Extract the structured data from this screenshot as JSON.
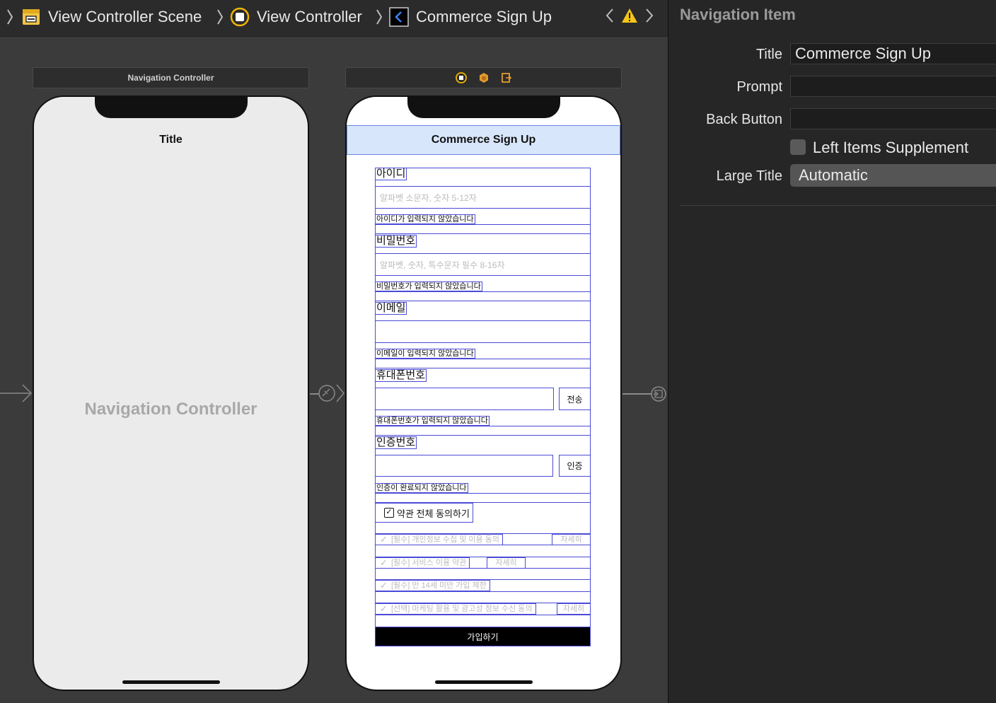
{
  "breadcrumb": {
    "items": [
      {
        "label": "View Controller Scene",
        "icon": "scene-icon"
      },
      {
        "label": "View Controller",
        "icon": "view-controller-icon"
      },
      {
        "label": "Commerce Sign Up",
        "icon": "navigation-item-icon"
      }
    ],
    "warning_icon": "warning-icon"
  },
  "canvas": {
    "nav_controller": {
      "scene_label": "Navigation Controller",
      "title": "Title",
      "placeholder": "Navigation Controller"
    },
    "view_controller": {
      "nav_title": "Commerce Sign Up",
      "fields": {
        "id_label": "아이디",
        "id_placeholder": "알파벳 소문자, 숫자 5-12자",
        "id_error": "아이디가 입력되지 않았습니다",
        "pw_label": "비밀번호",
        "pw_placeholder": "알파벳, 숫자, 특수문자 필수 8-16자",
        "pw_error": "비밀번호가 입력되지 않았습니다",
        "email_label": "이메일",
        "email_error": "이메일이 입력되지 않았습니다",
        "phone_label": "휴대폰번호",
        "phone_send": "전송",
        "phone_error": "휴대폰번호가 입력되지 않았습니다",
        "code_label": "인증번호",
        "code_verify": "인증",
        "code_error": "인증이 완료되지 않았습니다"
      },
      "terms": {
        "all": "약관 전체 동의하기",
        "items": [
          {
            "label": "[필수] 개인정보 수집 및 이용 동의",
            "detail": "자세히"
          },
          {
            "label": "[필수] 서비스 이용 약관",
            "detail": "자세히"
          },
          {
            "label": "[필수] 만 14세 미만 가입 제한",
            "detail": ""
          },
          {
            "label": "[선택] 마케팅 활용 및 광고성 정보 수신 동의",
            "detail": "자세히"
          }
        ]
      },
      "submit": "가입하기"
    }
  },
  "inspector": {
    "header": "Navigation Item",
    "title_label": "Title",
    "title_value": "Commerce Sign Up",
    "prompt_label": "Prompt",
    "prompt_value": "",
    "back_button_label": "Back Button",
    "back_button_value": "",
    "left_items_label": "Left Items Supplement",
    "large_title_label": "Large Title",
    "large_title_value": "Automatic"
  },
  "colors": {
    "constraint_blue": "#4a4ad8",
    "nav_bar_fill": "#d8e6fb",
    "canvas_bg": "#3b3b3b",
    "inspector_bg": "#262626"
  }
}
